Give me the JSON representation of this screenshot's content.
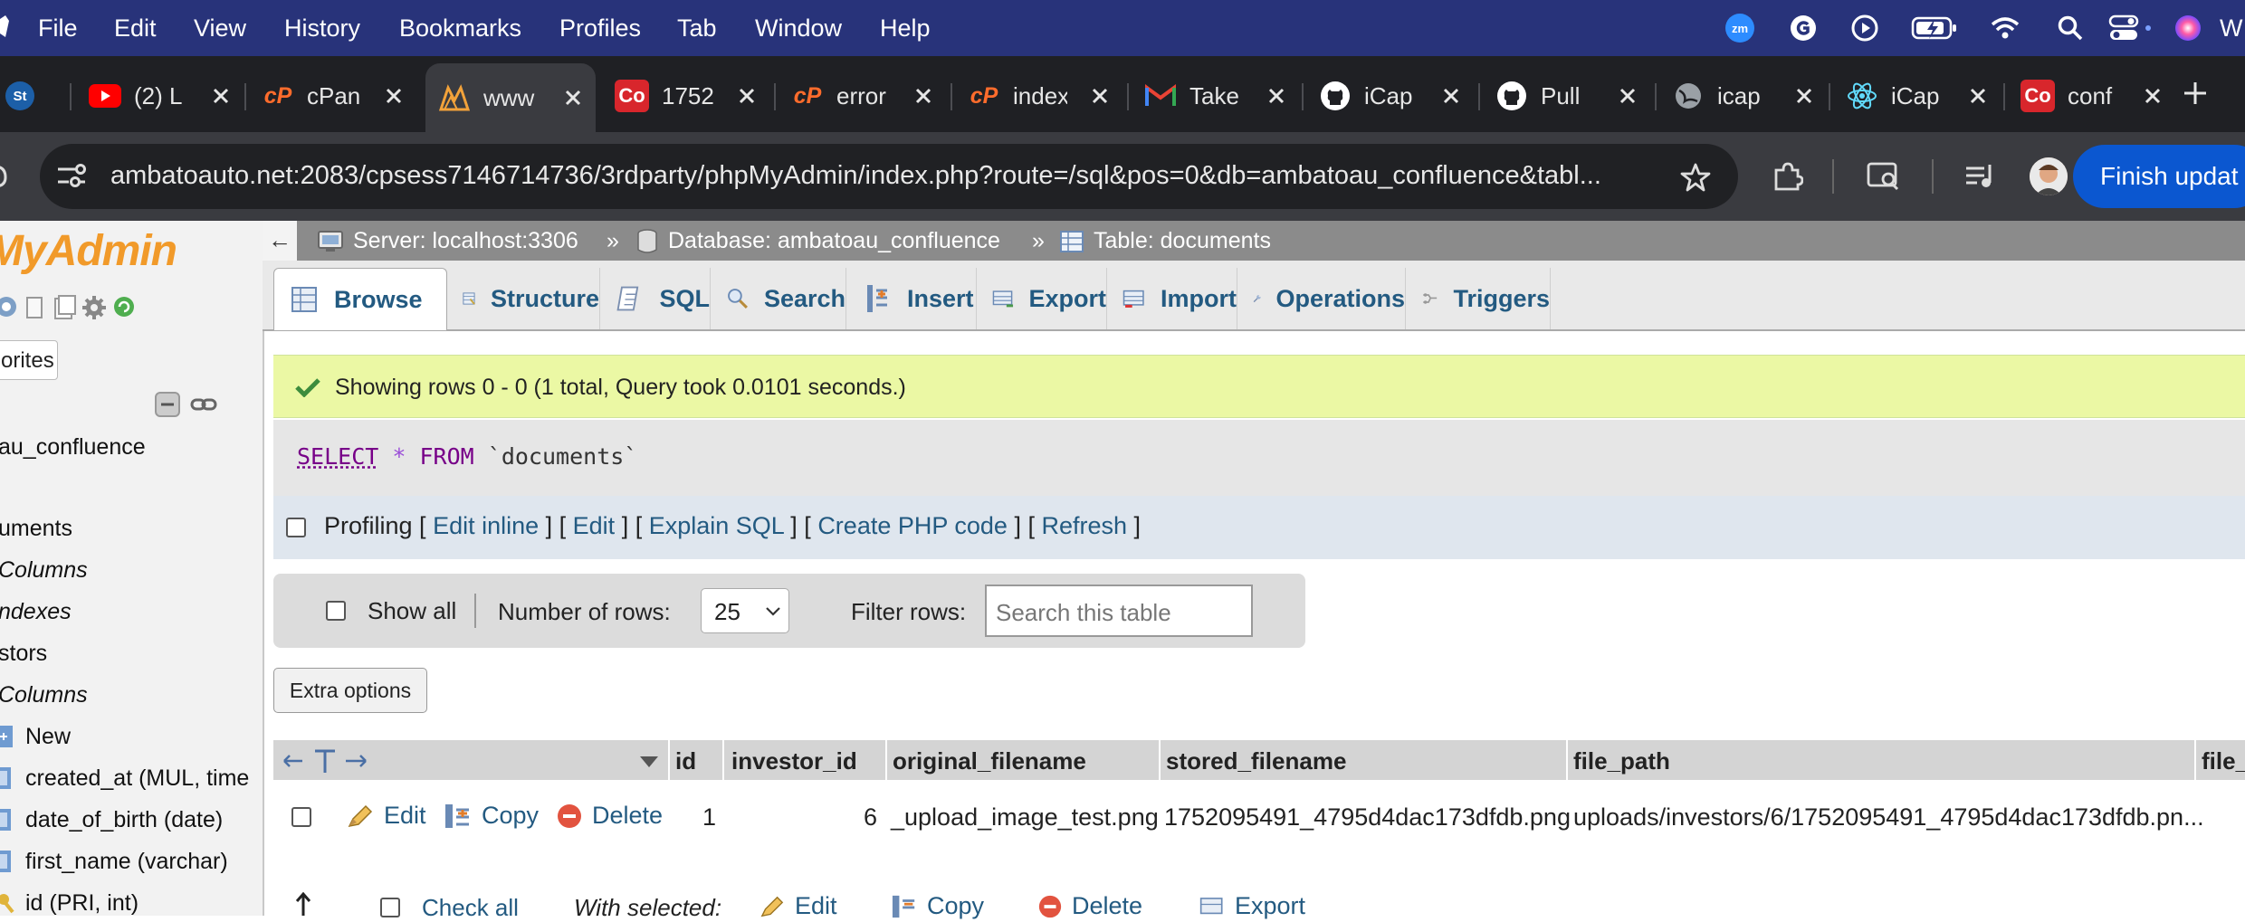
{
  "menubar": {
    "items": [
      "File",
      "Edit",
      "View",
      "History",
      "Bookmarks",
      "Profiles",
      "Tab",
      "Window",
      "Help"
    ],
    "zoom_badge": "zm",
    "right_letter": "W"
  },
  "tabs": [
    {
      "title": "",
      "icon": "stumbleupon-icon"
    },
    {
      "title": "(2) L",
      "icon": "youtube-icon"
    },
    {
      "title": "cPan",
      "icon": "cpanel-icon"
    },
    {
      "title": "www",
      "icon": "phpmyadmin-icon",
      "active": true
    },
    {
      "title": "1752",
      "icon": "co-icon"
    },
    {
      "title": "error",
      "icon": "cpanel-icon"
    },
    {
      "title": "index",
      "icon": "cpanel-icon"
    },
    {
      "title": "Take",
      "icon": "gmail-icon"
    },
    {
      "title": "iCap",
      "icon": "github-icon"
    },
    {
      "title": "Pull",
      "icon": "github-icon"
    },
    {
      "title": "icap",
      "icon": "globe-icon"
    },
    {
      "title": "iCap",
      "icon": "react-icon"
    },
    {
      "title": "conf",
      "icon": "co-icon"
    }
  ],
  "tab_letters": {
    "co": "Co",
    "cp": "cP",
    "st": "St"
  },
  "address": {
    "url": "ambatoauto.net:2083/cpsess7146714736/3rdparty/phpMyAdmin/index.php?route=/sql&pos=0&db=ambatoau_confluence&tabl...",
    "finish_label": "Finish updat"
  },
  "leftnav": {
    "logo": "MyAdmin",
    "favorites": "orites",
    "db_name": "au_confluence",
    "items": [
      {
        "label": "uments",
        "italic": false
      },
      {
        "label": "Columns",
        "italic": true
      },
      {
        "label": "ndexes",
        "italic": true
      },
      {
        "label": "stors",
        "italic": false
      },
      {
        "label": "Columns",
        "italic": true
      },
      {
        "label": "New",
        "italic": false
      },
      {
        "label": "created_at (MUL, time",
        "italic": false
      },
      {
        "label": "date_of_birth (date)",
        "italic": false
      },
      {
        "label": "first_name (varchar)",
        "italic": false
      },
      {
        "label": "id (PRI, int)",
        "italic": false
      }
    ]
  },
  "breadcrumb": {
    "back": "←",
    "server": "Server: localhost:3306",
    "sep": "»",
    "database": "Database: ambatoau_confluence",
    "table": "Table: documents"
  },
  "pma_tabs": [
    "Browse",
    "Structure",
    "SQL",
    "Search",
    "Insert",
    "Export",
    "Import",
    "Operations",
    "Triggers"
  ],
  "result": {
    "success": "Showing rows 0 - 0 (1 total, Query took 0.0101 seconds.)",
    "sql_keyword": "SELECT",
    "sql_star": "*",
    "sql_from": "FROM",
    "sql_table": "`documents`",
    "profiling": "Profiling",
    "links": [
      "Edit inline",
      "Edit",
      "Explain SQL",
      "Create PHP code",
      "Refresh"
    ]
  },
  "controls": {
    "show_all": "Show all",
    "number_of_rows": "Number of rows:",
    "rows_value": "25",
    "filter_label": "Filter rows:",
    "filter_placeholder": "Search this table",
    "extra_options": "Extra options"
  },
  "table": {
    "columns": [
      "id",
      "investor_id",
      "original_filename",
      "stored_filename",
      "file_path",
      "file_"
    ],
    "rows": [
      {
        "id": "1",
        "investor_id": "6",
        "original_filename": "_upload_image_test.png",
        "stored_filename": "1752095491_4795d4dac173dfdb.png",
        "file_path": "uploads/investors/6/1752095491_4795d4dac173dfdb.pn..."
      }
    ],
    "row_actions": [
      "Edit",
      "Copy",
      "Delete"
    ]
  },
  "bottom": {
    "check_all": "Check all",
    "with_selected": "With selected:",
    "actions": [
      "Edit",
      "Copy",
      "Delete",
      "Export"
    ]
  },
  "colors": {
    "menubar": "#28337a",
    "link": "#235a81",
    "success_bg": "#ebf8a4",
    "logo": "#f19a2a",
    "finish_button": "#0b57d0"
  }
}
